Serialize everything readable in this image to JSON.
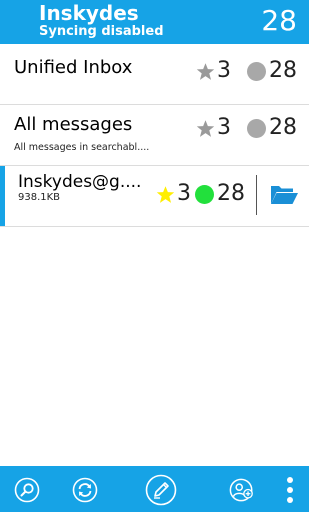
{
  "header": {
    "app_name": "Inskydes",
    "sync_status": "Syncing disabled",
    "total_count": "28"
  },
  "accounts": [
    {
      "title": "Unified Inbox",
      "subtitle": "",
      "starred_count": "3",
      "message_count": "28"
    },
    {
      "title": "All messages",
      "subtitle": "All messages in searchabl....",
      "starred_count": "3",
      "message_count": "28"
    },
    {
      "title": "Inskydes@g....",
      "subtitle": "938.1KB",
      "starred_count": "3",
      "message_count": "28"
    }
  ],
  "icons": {
    "star_inactive": "star-icon",
    "star_active": "star-icon",
    "unread_inactive": "circle-icon",
    "unread_active": "circle-icon",
    "folder": "folder-open-icon",
    "search": "search-icon",
    "sync": "sync-icon",
    "compose": "compose-icon",
    "add_account": "add-account-icon",
    "menu": "overflow-menu-icon"
  },
  "colors": {
    "accent": "#16a3e6",
    "star_inactive": "#9a9a9a",
    "star_active": "#ffee00",
    "dot_inactive": "#a8a8a8",
    "dot_active": "#22e03c"
  }
}
